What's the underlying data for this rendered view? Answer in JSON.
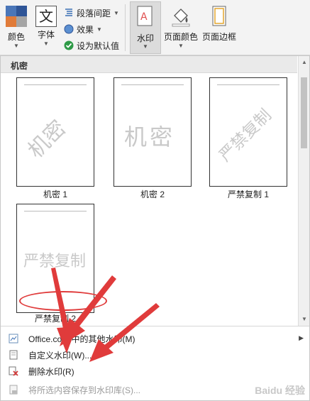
{
  "ribbon": {
    "colors_label": "颜色",
    "fonts_label": "字体",
    "fonts_glyph": "文",
    "paragraph_spacing_label": "段落间距",
    "effects_label": "效果",
    "set_default_label": "设为默认值",
    "watermark_label": "水印",
    "page_color_label": "页面颜色",
    "page_borders_label": "页面边框"
  },
  "gallery": {
    "section_title": "机密",
    "thumbnails": [
      {
        "label": "机密 1",
        "watermark_text": "机密"
      },
      {
        "label": "机密 2",
        "watermark_text": "机密"
      },
      {
        "label": "严禁复制 1",
        "watermark_text": "严禁复制"
      },
      {
        "label": "严禁复制 2",
        "watermark_text": "严禁复制"
      }
    ]
  },
  "menu": {
    "office_more": "Office.com 中的其他水印(M)",
    "custom_watermark": "自定义水印(W)...",
    "remove_watermark": "删除水印(R)",
    "save_to_gallery": "将所选内容保存到水印库(S)..."
  },
  "colors": {
    "annotation_red": "#e03b3b",
    "ribbon_bg": "#f3f3f3",
    "header_bg": "#eaeaea"
  },
  "corner_mark": "Baidu 经验"
}
